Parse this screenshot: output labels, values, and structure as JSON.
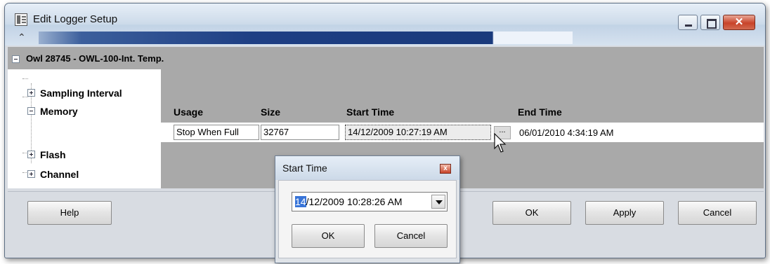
{
  "window": {
    "title": "Edit Logger Setup",
    "close_glyph": "✕"
  },
  "group": {
    "title": "Owl 28745 - OWL-100-Int. Temp."
  },
  "tree": {
    "items": [
      {
        "label": "Sampling Interval",
        "expanded": false
      },
      {
        "label": "Memory",
        "expanded": true
      },
      {
        "label": "Flash",
        "expanded": false
      },
      {
        "label": "Channel",
        "expanded": false
      }
    ]
  },
  "memory": {
    "columns": [
      "Usage",
      "Size",
      "Start Time",
      "End Time"
    ],
    "row": {
      "usage": "Stop When Full",
      "size": "32767",
      "start_time": "14/12/2009 10:27:19 AM",
      "ellipsis": "...",
      "end_time": "06/01/2010 4:34:19 AM"
    }
  },
  "buttons": {
    "help": "Help",
    "ok": "OK",
    "apply": "Apply",
    "cancel": "Cancel"
  },
  "popup": {
    "title": "Start Time",
    "close_glyph": "x",
    "date_selected_segment": "14",
    "date_rest": "/12/2009 10:28:26 AM",
    "ok": "OK",
    "cancel": "Cancel"
  },
  "colors": {
    "accent": "#1e3f84",
    "selection": "#3874d8",
    "group_background": "#a9a9a9"
  }
}
